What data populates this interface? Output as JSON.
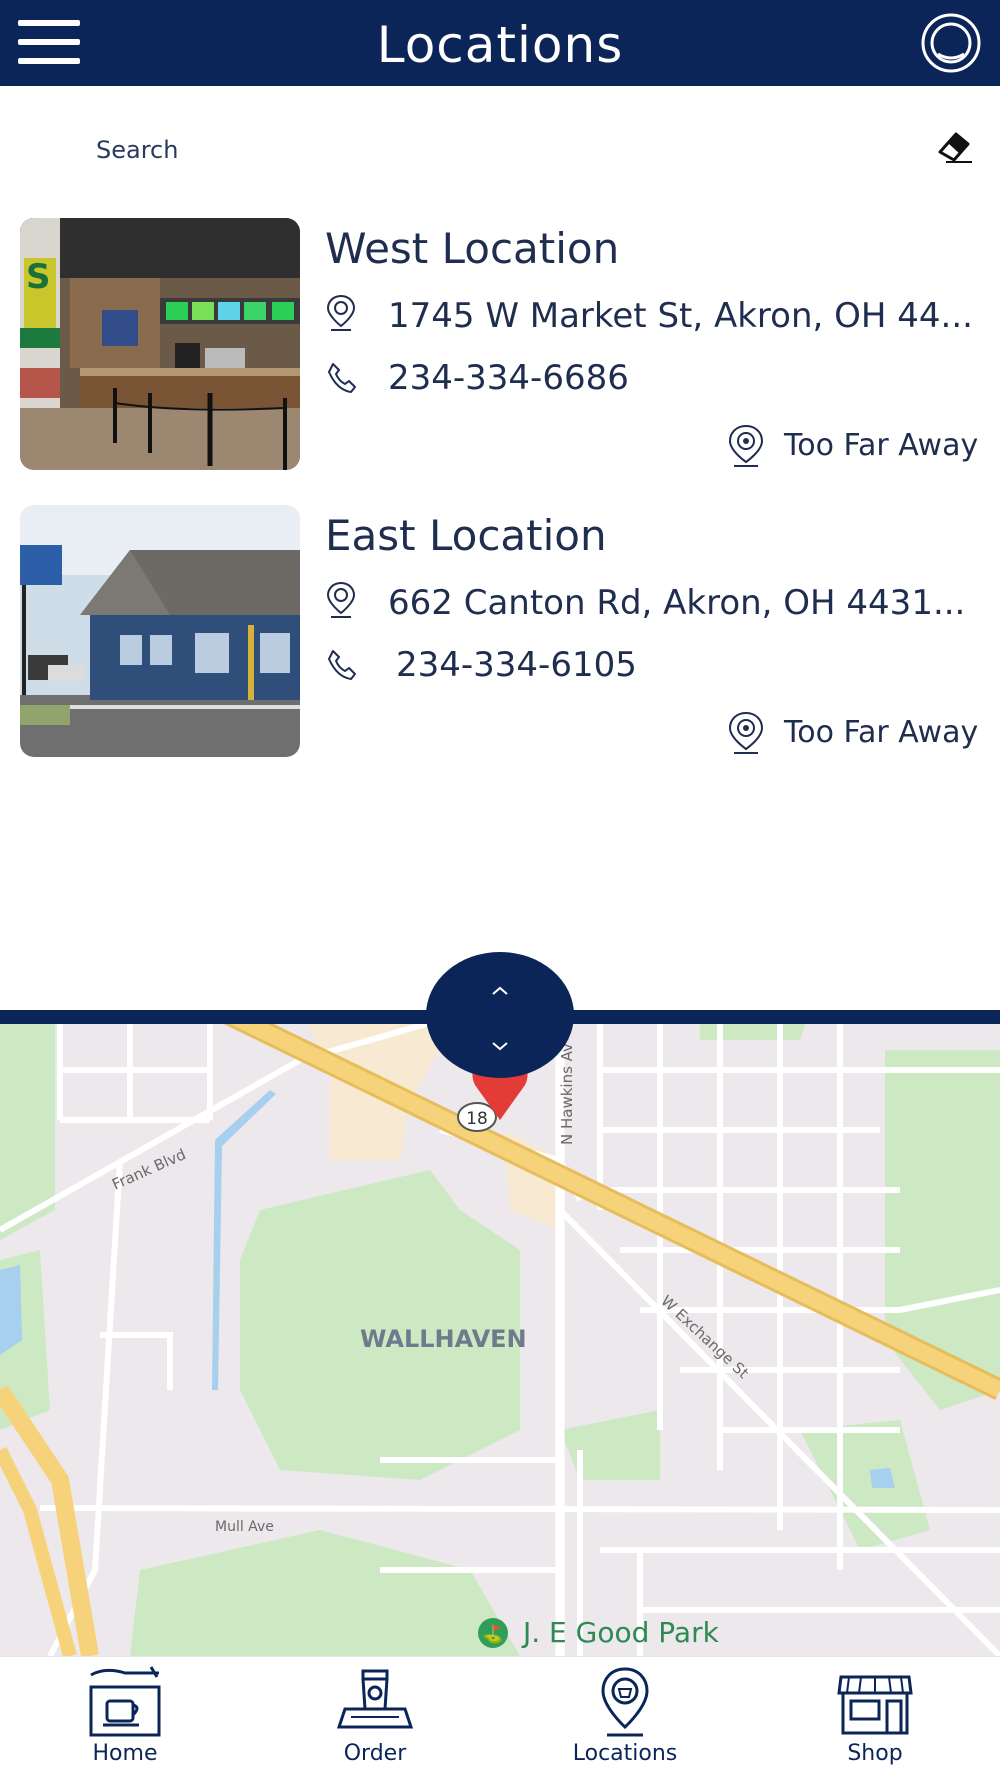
{
  "header": {
    "title": "Locations",
    "menu_icon": "hamburger-menu-icon",
    "profile_icon": "profile-icon"
  },
  "search": {
    "placeholder": "Search",
    "clear_icon": "eraser-icon"
  },
  "locations": [
    {
      "name": "West Location",
      "address": "1745 W Market St, Akron, OH 44...",
      "phone": "234-334-6686",
      "distance": "Too Far Away"
    },
    {
      "name": "East Location",
      "address": "662 Canton Rd, Akron, OH 4431...",
      "phone": "234-334-6105",
      "distance": "Too Far Away"
    }
  ],
  "map": {
    "neighborhood": "WALLHAVEN",
    "streets": [
      "Frank Blvd",
      "N Hawkins Av",
      "W Exchange St",
      "Mull Ave"
    ],
    "route": "18",
    "poi": "J. E Good Park"
  },
  "nav": [
    {
      "label": "Home",
      "icon": "home-cafe-icon"
    },
    {
      "label": "Order",
      "icon": "order-coffee-icon"
    },
    {
      "label": "Locations",
      "icon": "location-pin-icon"
    },
    {
      "label": "Shop",
      "icon": "shop-storefront-icon"
    }
  ],
  "colors": {
    "primary": "#0b2559",
    "marker": "#e33b36",
    "highway": "#f6d27a",
    "park": "#cde9c4"
  }
}
